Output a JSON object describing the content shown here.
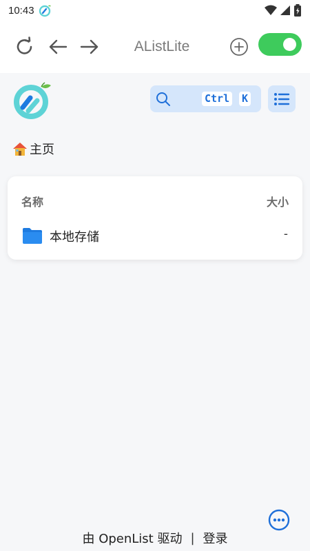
{
  "status_bar": {
    "time": "10:43"
  },
  "toolbar": {
    "title": "AListLite"
  },
  "search": {
    "shortcut_key_1": "Ctrl",
    "shortcut_key_2": "K"
  },
  "breadcrumb": {
    "home_label": "主页"
  },
  "file_list": {
    "columns": {
      "name": "名称",
      "size": "大小"
    },
    "rows": [
      {
        "name": "本地存储",
        "size": "-"
      }
    ]
  },
  "footer": {
    "powered_by": "由 OpenList 驱动",
    "separator": "|",
    "login": "登录"
  },
  "colors": {
    "accent": "#1e88e5",
    "toggle_on": "#3ecb5c",
    "search_bg": "#d5e6fb",
    "logo_teal": "#5ed3d6",
    "logo_blue": "#1e7be0"
  }
}
